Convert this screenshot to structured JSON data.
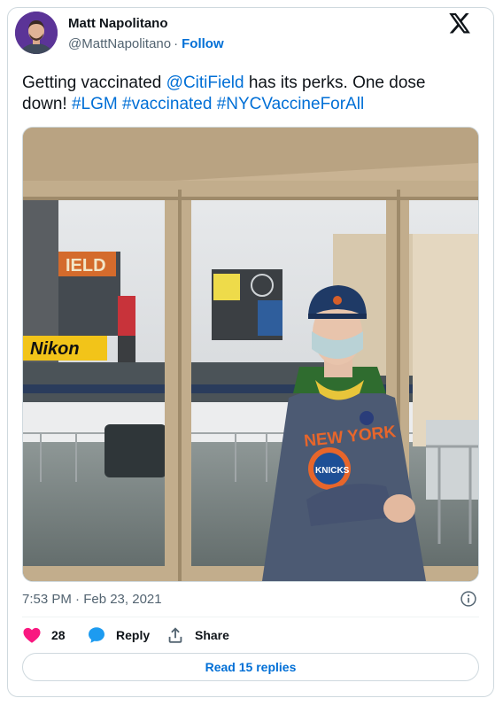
{
  "author": {
    "name": "Matt Napolitano",
    "handle": "@MattNapolitano",
    "separator": "·",
    "follow_label": "Follow"
  },
  "tweet": {
    "segments": [
      {
        "text": "Getting vaccinated ",
        "type": "text"
      },
      {
        "text": "@CitiField",
        "type": "mention"
      },
      {
        "text": " has its perks. One dose down! ",
        "type": "text"
      },
      {
        "text": "#LGM",
        "type": "hashtag"
      },
      {
        "text": " ",
        "type": "text"
      },
      {
        "text": "#vaccinated",
        "type": "hashtag"
      },
      {
        "text": " ",
        "type": "text"
      },
      {
        "text": "#NYCVaccineForAll",
        "type": "hashtag"
      }
    ]
  },
  "media": {
    "icon": "photo",
    "signs": {
      "nikon": "Nikon",
      "field": "IELD",
      "shirt_line1": "NEW YORK",
      "shirt_logo": "KNICKS"
    }
  },
  "meta": {
    "timestamp": "7:53 PM · Feb 23, 2021"
  },
  "actions": {
    "like_count": "28",
    "reply_label": "Reply",
    "share_label": "Share",
    "read_replies_label": "Read 15 replies"
  },
  "colors": {
    "link": "#006fd6",
    "heart": "#f91880",
    "reply_bubble": "#1d9bf0",
    "secondary_text": "#536471",
    "border": "#cfd9de"
  },
  "icons": {
    "brand": "x-logo-icon",
    "info": "info-icon",
    "like": "heart-icon",
    "reply": "reply-bubble-icon",
    "share": "share-icon"
  }
}
